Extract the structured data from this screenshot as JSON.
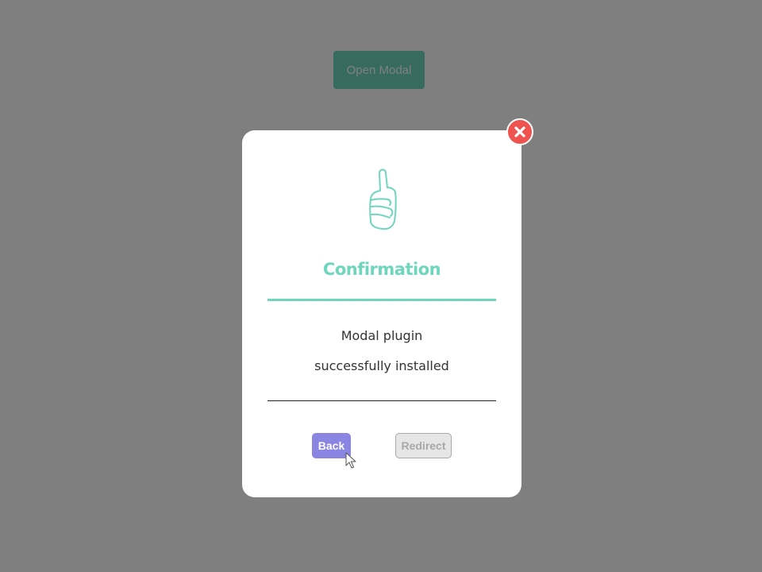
{
  "page": {
    "open_modal_label": "Open Modal"
  },
  "modal": {
    "icon": "thumbs-up-icon",
    "title": "Confirmation",
    "message_line_1": "Modal plugin",
    "message_line_2": "successfully installed",
    "back_label": "Back",
    "redirect_label": "Redirect",
    "close_icon": "close-icon"
  },
  "colors": {
    "accent": "#6fd6bd",
    "back_button": "#8a84e2",
    "close_button": "#ef5350",
    "overlay": "rgba(0,0,0,0.5)"
  }
}
